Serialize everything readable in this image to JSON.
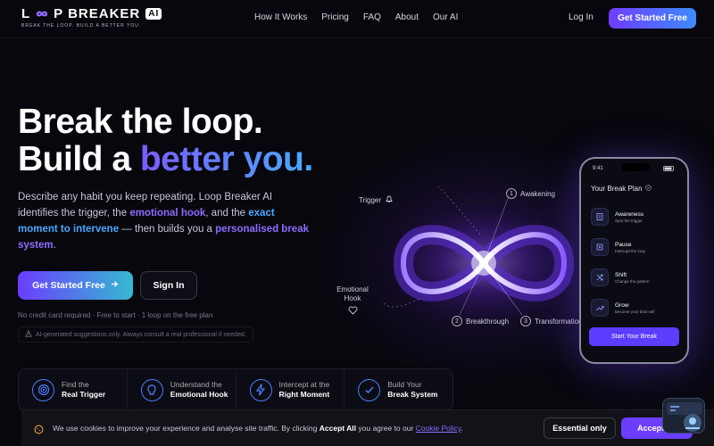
{
  "brand": {
    "name_pre": "L",
    "name_post": "P BREAKER",
    "ai_badge": "AI",
    "tagline": "BREAK THE LOOP. BUILD A BETTER YOU."
  },
  "nav": {
    "links": [
      "How It Works",
      "Pricing",
      "FAQ",
      "About",
      "Our AI"
    ],
    "login": "Log In",
    "cta": "Get Started Free"
  },
  "hero": {
    "line1": "Break the loop.",
    "line2_a": "Build a ",
    "line2_b": "better you.",
    "desc": {
      "p1": "Describe any habit you keep repeating. Loop Breaker AI identifies the trigger, the ",
      "h1": "emotional hook",
      "p2": ", and the ",
      "h2": "exact moment to intervene",
      "p3": " — then builds you a ",
      "h3": "personalised break system",
      "p4": "."
    },
    "primary_button": "Get Started Free",
    "secondary_button": "Sign In",
    "note": "No credit card required · Free to start · 1 loop on the free plan",
    "disclaimer": "AI-generated suggestions only. Always consult a real professional if needed."
  },
  "features": [
    {
      "top": "Find the",
      "bottom": "Real Trigger"
    },
    {
      "top": "Understand the",
      "bottom": "Emotional Hook"
    },
    {
      "top": "Intercept at the",
      "bottom": "Right Moment"
    },
    {
      "top": "Build Your",
      "bottom": "Break System"
    }
  ],
  "loop_labels": {
    "trigger": "Trigger",
    "awakening": "Awakening",
    "emotional": "Emotional",
    "hook": "Hook",
    "breakthrough": "Breakthrough",
    "transformation": "Transformation",
    "n1": "1",
    "n2": "2",
    "n3": "3"
  },
  "phone": {
    "time": "9:41",
    "title": "Your Break Plan",
    "steps": [
      {
        "title": "Awareness",
        "sub": "Spot the trigger"
      },
      {
        "title": "Pause",
        "sub": "Interrupt the loop"
      },
      {
        "title": "Shift",
        "sub": "Change the pattern"
      },
      {
        "title": "Grow",
        "sub": "Become your best self"
      }
    ],
    "button": "Start Your Break"
  },
  "cookie": {
    "text1": "We use cookies to improve your experience and analyse site traffic. By clicking ",
    "bold": "Accept All",
    "text2": " you agree to our ",
    "link": "Cookie Policy",
    "text3": ".",
    "essential": "Essential only",
    "accept": "Accept All"
  },
  "colors": {
    "accent": "#6b3dff",
    "accent2": "#4aa8ff",
    "background": "#07070d"
  }
}
